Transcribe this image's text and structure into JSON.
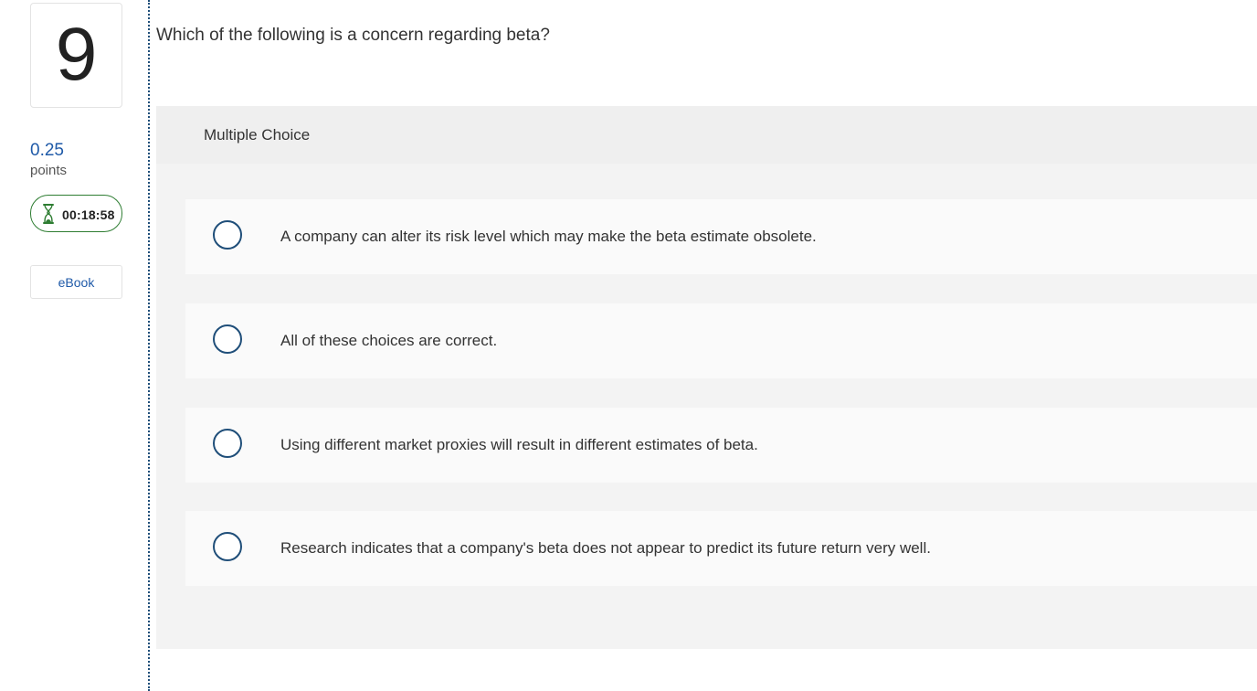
{
  "sidebar": {
    "question_number": "9",
    "points_value": "0.25",
    "points_label": "points",
    "timer": "00:18:58",
    "timer_icon": "hourglass-icon",
    "ebook_label": "eBook"
  },
  "question": {
    "text": "Which of the following is a concern regarding beta?",
    "type_label": "Multiple Choice",
    "choices": [
      {
        "text": "A company can alter its risk level which may make the beta estimate obsolete.",
        "selected": false
      },
      {
        "text": "All of these choices are correct.",
        "selected": false
      },
      {
        "text": "Using different market proxies will result in different estimates of beta.",
        "selected": false
      },
      {
        "text": "Research indicates that a company's beta does not appear to predict its future return very well.",
        "selected": false
      }
    ]
  },
  "colors": {
    "accent": "#1f5aa8",
    "radio_border": "#1f4e79",
    "timer_border": "#2e7d32",
    "panel_bg": "#f3f3f3",
    "choice_bg": "#fafafa"
  }
}
